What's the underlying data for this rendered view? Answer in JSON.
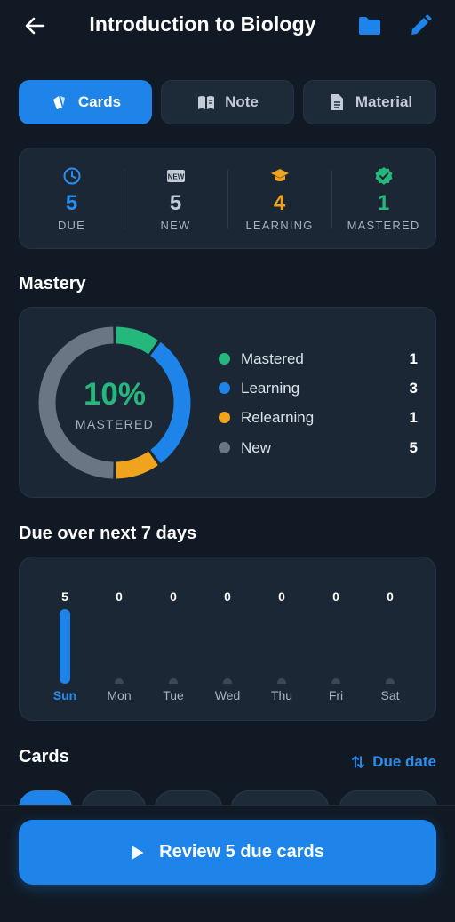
{
  "header": {
    "title": "Introduction to Biology",
    "back_icon": "arrow-left-icon",
    "folder_icon": "folder-icon",
    "edit_icon": "pencil-icon"
  },
  "tabs": [
    {
      "label": "Cards",
      "icon": "cards-icon",
      "active": true
    },
    {
      "label": "Note",
      "icon": "book-icon",
      "active": false
    },
    {
      "label": "Material",
      "icon": "document-icon",
      "active": false
    }
  ],
  "stats": [
    {
      "value": "5",
      "label": "DUE",
      "icon": "clock-icon",
      "color": "#2a8ef0"
    },
    {
      "value": "5",
      "label": "NEW",
      "icon": "new-badge-icon",
      "color": "#c3ccd6"
    },
    {
      "value": "4",
      "label": "LEARNING",
      "icon": "graduation-cap-icon",
      "color": "#f0a31e"
    },
    {
      "value": "1",
      "label": "MASTERED",
      "icon": "verified-badge-icon",
      "color": "#24b87d"
    }
  ],
  "mastery": {
    "title": "Mastery",
    "percent": "10%",
    "percent_label": "MASTERED",
    "items": [
      {
        "name": "Mastered",
        "value": 1,
        "color": "#24b87d"
      },
      {
        "name": "Learning",
        "value": 3,
        "color": "#1e84ea"
      },
      {
        "name": "Relearning",
        "value": 1,
        "color": "#f0a31e"
      },
      {
        "name": "New",
        "value": 5,
        "color": "#6b7684"
      }
    ]
  },
  "due": {
    "title": "Due over next 7 days",
    "days": [
      {
        "name": "Sun",
        "count": 5,
        "today": true
      },
      {
        "name": "Mon",
        "count": 0,
        "today": false
      },
      {
        "name": "Tue",
        "count": 0,
        "today": false
      },
      {
        "name": "Wed",
        "count": 0,
        "today": false
      },
      {
        "name": "Thu",
        "count": 0,
        "today": false
      },
      {
        "name": "Fri",
        "count": 0,
        "today": false
      },
      {
        "name": "Sat",
        "count": 0,
        "today": false
      }
    ]
  },
  "cards": {
    "title": "Cards",
    "sort_label": "Due date",
    "sort_icon": "sort-arrows-icon"
  },
  "review": {
    "label": "Review 5 due cards",
    "icon": "play-icon"
  }
}
